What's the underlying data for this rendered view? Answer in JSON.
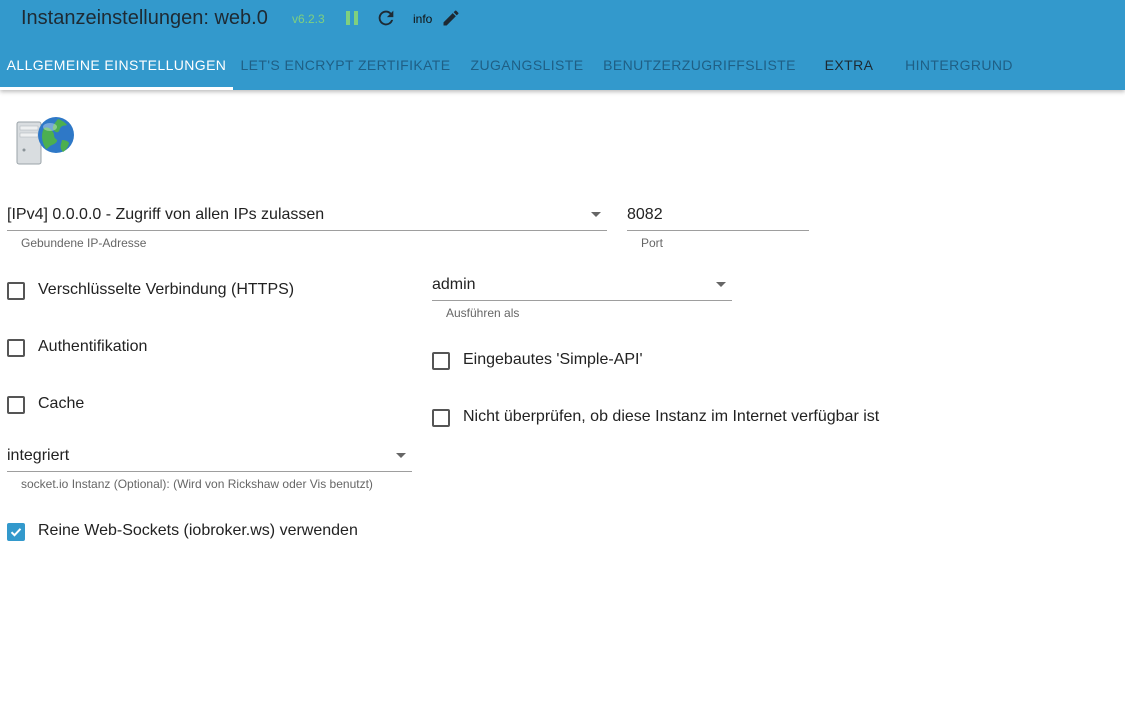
{
  "header": {
    "title": "Instanzeinstellungen: web.0",
    "version": "v6.2.3",
    "loglevel": "info",
    "status_color": "#7fd07f"
  },
  "tabs": [
    {
      "label": "ALLGEMEINE EINSTELLUNGEN",
      "active": true
    },
    {
      "label": "LET'S ENCRYPT ZERTIFIKATE",
      "active": false
    },
    {
      "label": "ZUGANGSLISTE",
      "active": false
    },
    {
      "label": "BENUTZERZUGRIFFSLISTE",
      "active": false
    },
    {
      "label": "EXTRA",
      "active": false
    },
    {
      "label": "HINTERGRUND",
      "active": false
    }
  ],
  "form": {
    "bind_ip": {
      "value": "[IPv4] 0.0.0.0 - Zugriff von allen IPs zulassen",
      "helper": "Gebundene IP-Adresse"
    },
    "port": {
      "value": "8082",
      "helper": "Port"
    },
    "https": {
      "label": "Verschlüsselte Verbindung (HTTPS)",
      "checked": false
    },
    "run_as": {
      "value": "admin",
      "helper": "Ausführen als"
    },
    "auth": {
      "label": "Authentifikation",
      "checked": false
    },
    "simple_api": {
      "label": "Eingebautes 'Simple-API'",
      "checked": false
    },
    "cache": {
      "label": "Cache",
      "checked": false
    },
    "no_check": {
      "label": "Nicht überprüfen, ob diese Instanz im Internet verfügbar ist",
      "checked": false
    },
    "socketio": {
      "value": "integriert",
      "helper": "socket.io Instanz (Optional): (Wird von Rickshaw oder Vis benutzt)"
    },
    "pure_ws": {
      "label": "Reine Web-Sockets (iobroker.ws) verwenden",
      "checked": true
    }
  },
  "colors": {
    "primary": "#3399cc",
    "tab_inactive": "#1f5f85"
  },
  "icons": [
    "pause-icon",
    "reload-icon",
    "edit-icon",
    "server-globe-icon",
    "dropdown-arrow-icon",
    "check-icon"
  ]
}
